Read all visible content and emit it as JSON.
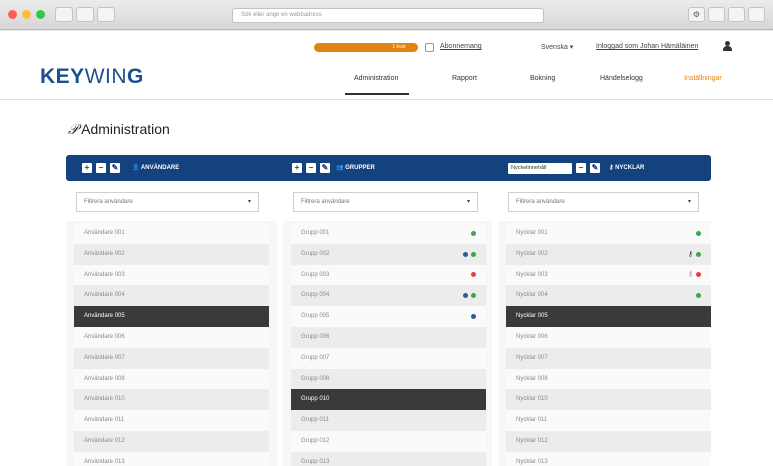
{
  "browser": {
    "url_placeholder": "Sök eller ange en webbadress",
    "window_controls": [
      "red",
      "yellow",
      "green"
    ]
  },
  "utility_bar": {
    "progress_label": "1 kvar",
    "abonnemang": "Abonnemang",
    "language": "Svenska ▾",
    "user": "Inloggad som Johan Hämäläinen"
  },
  "logo": {
    "bold": "KEY",
    "light": "WIN",
    "end": "G"
  },
  "nav": {
    "items": [
      "Administration",
      "Rapport",
      "Bokning",
      "Händelselogg",
      "Inställningar"
    ],
    "active_index": 0
  },
  "page_title": "Administration",
  "toolbar": {
    "users_label": "ANVÄNDARE",
    "groups_label": "GRUPPER",
    "keys_label": "NYCKLAR",
    "key_select": "Nyckelinnehåll"
  },
  "colors": {
    "accent_blue": "#13427f",
    "orange": "#e28310",
    "selected_row": "#3a3a3a"
  },
  "columns": {
    "users": {
      "filter_placeholder": "Filtrera användare",
      "rows": [
        "Användare 001",
        "Användare 002",
        "Användare 003",
        "Användare 004",
        "Användare 005",
        "Användare 006",
        "Användare 007",
        "Användare 008",
        "Användare 010",
        "Användare 011",
        "Användare 012",
        "Användare 013"
      ],
      "selected_index": 4
    },
    "groups": {
      "filter_placeholder": "Filtrera användare",
      "rows": [
        "Grupp 001",
        "Grupp 002",
        "Grupp 003",
        "Grupp 004",
        "Grupp 005",
        "Grupp 006",
        "Grupp 007",
        "Grupp 008",
        "Grupp 010",
        "Grupp 011",
        "Grupp 012",
        "Grupp 013"
      ],
      "selected_index": 8
    },
    "keys": {
      "filter_placeholder": "Filtrera användare",
      "rows": [
        "Nycklar 001",
        "Nycklar 002",
        "Nycklar 003",
        "Nycklar 004",
        "Nycklar 005",
        "Nycklar 006",
        "Nycklar 007",
        "Nycklar 008",
        "Nycklar 010",
        "Nycklar 011",
        "Nycklar 012",
        "Nycklar 013"
      ],
      "selected_index": 4
    }
  }
}
